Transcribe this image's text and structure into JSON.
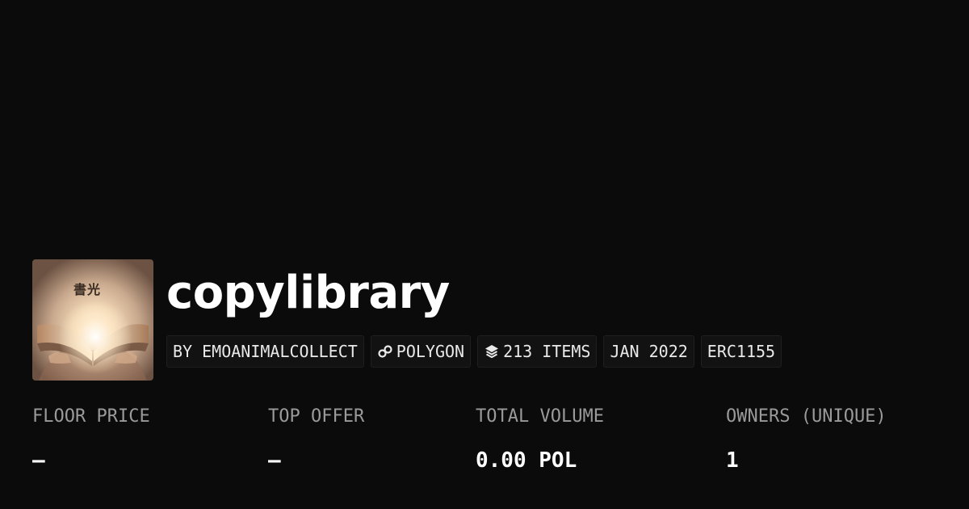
{
  "collection": {
    "name": "copylibrary",
    "image_caption": "書光",
    "badges": {
      "creator": "BY EMOANIMALCOLLECT",
      "chain": "POLYGON",
      "chain_icon": "link-icon",
      "items": "213 ITEMS",
      "items_icon": "layers-icon",
      "created": "JAN 2022",
      "standard": "ERC1155"
    }
  },
  "stats": {
    "floor_price": {
      "label": "FLOOR PRICE",
      "value": "–"
    },
    "top_offer": {
      "label": "TOP OFFER",
      "value": "–"
    },
    "total_volume": {
      "label": "TOTAL VOLUME",
      "value": "0.00 POL"
    },
    "owners": {
      "label": "OWNERS (UNIQUE)",
      "value": "1"
    }
  },
  "colors": {
    "background": "#0b0b0c",
    "text_primary": "#ffffff",
    "text_muted": "#9a9a9a",
    "badge_background": "#121213"
  }
}
